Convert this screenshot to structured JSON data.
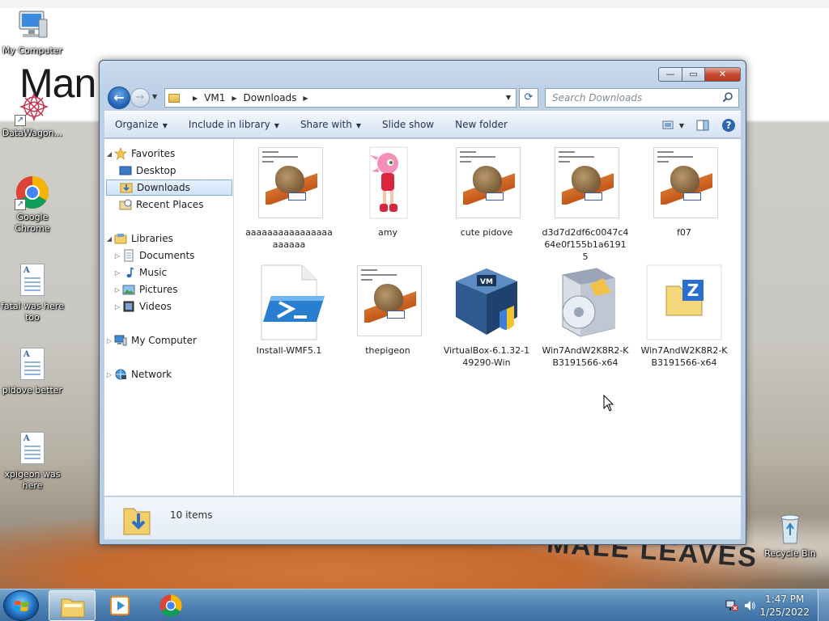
{
  "desktop": {
    "icons": [
      {
        "label": "My Computer"
      },
      {
        "label": "DataWagon..."
      },
      {
        "label": "Google Chrome"
      },
      {
        "label": "fatal was here too"
      },
      {
        "label": "pidove better"
      },
      {
        "label": "xpigeon was here"
      },
      {
        "label": "Recycle Bin"
      }
    ],
    "wallpaper": {
      "top_text": "Man",
      "bottom_text": "MALE LEAVES"
    }
  },
  "window": {
    "controls": {
      "minimize": "—",
      "maximize": "▭",
      "close": "✕"
    },
    "address": {
      "crumbs": [
        "VM1",
        "Downloads"
      ]
    },
    "search": {
      "placeholder": "Search Downloads"
    },
    "toolbar": {
      "organize": "Organize",
      "include_in_library": "Include in library",
      "share_with": "Share with",
      "slide_show": "Slide show",
      "new_folder": "New folder"
    },
    "nav": {
      "favorites": "Favorites",
      "desktop": "Desktop",
      "downloads": "Downloads",
      "recent_places": "Recent Places",
      "libraries": "Libraries",
      "documents": "Documents",
      "music": "Music",
      "pictures": "Pictures",
      "videos": "Videos",
      "my_computer": "My Computer",
      "network": "Network"
    },
    "files": [
      {
        "name": "aaaaaaaaaaaaaaaaaaaaaa",
        "kind": "image-pigeon"
      },
      {
        "name": "amy",
        "kind": "image-amy"
      },
      {
        "name": "cute pidove",
        "kind": "image-pigeon"
      },
      {
        "name": "d3d7d2df6c0047c464e0f155b1a61915",
        "kind": "image-pigeon"
      },
      {
        "name": "f07",
        "kind": "image-pigeon"
      },
      {
        "name": "Install-WMF5.1",
        "kind": "powershell"
      },
      {
        "name": "thepigeon",
        "kind": "image-pigeon"
      },
      {
        "name": "VirtualBox-6.1.32-149290-Win",
        "kind": "virtualbox"
      },
      {
        "name": "Win7AndW2K8R2-KB3191566-x64",
        "kind": "installer"
      },
      {
        "name": "Win7AndW2K8R2-KB3191566-x64",
        "kind": "zip"
      }
    ],
    "status": {
      "count_text": "10 items"
    }
  },
  "taskbar": {
    "clock": {
      "time": "1:47 PM",
      "date": "1/25/2022"
    }
  },
  "colors": {
    "accent": "#1f5fb0",
    "selection": "#cfe3f8",
    "taskbar": "#4f86bb"
  }
}
